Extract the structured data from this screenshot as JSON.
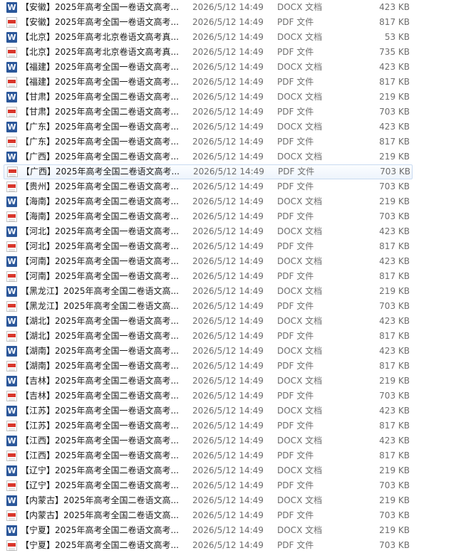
{
  "files": [
    {
      "name": "【安徽】2025年高考全国一卷语文高考...",
      "date": "2026/5/12 14:49",
      "type": "DOCX 文档",
      "size": "423 KB",
      "icon": "docx-icon",
      "selected": false
    },
    {
      "name": "【安徽】2025年高考全国一卷语文高考...",
      "date": "2026/5/12 14:49",
      "type": "PDF 文件",
      "size": "817 KB",
      "icon": "pdf-icon",
      "selected": false
    },
    {
      "name": "【北京】2025年高考北京卷语文高考真...",
      "date": "2026/5/12 14:49",
      "type": "DOCX 文档",
      "size": "53 KB",
      "icon": "docx-icon",
      "selected": false
    },
    {
      "name": "【北京】2025年高考北京卷语文高考真...",
      "date": "2026/5/12 14:49",
      "type": "PDF 文件",
      "size": "735 KB",
      "icon": "pdf-icon",
      "selected": false
    },
    {
      "name": "【福建】2025年高考全国一卷语文高考...",
      "date": "2026/5/12 14:49",
      "type": "DOCX 文档",
      "size": "423 KB",
      "icon": "docx-icon",
      "selected": false
    },
    {
      "name": "【福建】2025年高考全国一卷语文高考...",
      "date": "2026/5/12 14:49",
      "type": "PDF 文件",
      "size": "817 KB",
      "icon": "pdf-icon",
      "selected": false
    },
    {
      "name": "【甘肃】2025年高考全国二卷语文高考...",
      "date": "2026/5/12 14:49",
      "type": "DOCX 文档",
      "size": "219 KB",
      "icon": "docx-icon",
      "selected": false
    },
    {
      "name": "【甘肃】2025年高考全国二卷语文高考...",
      "date": "2026/5/12 14:49",
      "type": "PDF 文件",
      "size": "703 KB",
      "icon": "pdf-icon",
      "selected": false
    },
    {
      "name": "【广东】2025年高考全国一卷语文高考...",
      "date": "2026/5/12 14:49",
      "type": "DOCX 文档",
      "size": "423 KB",
      "icon": "docx-icon",
      "selected": false
    },
    {
      "name": "【广东】2025年高考全国一卷语文高考...",
      "date": "2026/5/12 14:49",
      "type": "PDF 文件",
      "size": "817 KB",
      "icon": "pdf-icon",
      "selected": false
    },
    {
      "name": "【广西】2025年高考全国二卷语文高考...",
      "date": "2026/5/12 14:49",
      "type": "DOCX 文档",
      "size": "219 KB",
      "icon": "docx-icon",
      "selected": false
    },
    {
      "name": "【广西】2025年高考全国二卷语文高考...",
      "date": "2026/5/12 14:49",
      "type": "PDF 文件",
      "size": "703 KB",
      "icon": "pdf-icon",
      "selected": true
    },
    {
      "name": "【贵州】2025年高考全国二卷语文高考...",
      "date": "2026/5/12 14:49",
      "type": "PDF 文件",
      "size": "703 KB",
      "icon": "pdf-icon",
      "selected": false
    },
    {
      "name": "【海南】2025年高考全国二卷语文高考...",
      "date": "2026/5/12 14:49",
      "type": "DOCX 文档",
      "size": "219 KB",
      "icon": "docx-icon",
      "selected": false
    },
    {
      "name": "【海南】2025年高考全国二卷语文高考...",
      "date": "2026/5/12 14:49",
      "type": "PDF 文件",
      "size": "703 KB",
      "icon": "pdf-icon",
      "selected": false
    },
    {
      "name": "【河北】2025年高考全国一卷语文高考...",
      "date": "2026/5/12 14:49",
      "type": "DOCX 文档",
      "size": "423 KB",
      "icon": "docx-icon",
      "selected": false
    },
    {
      "name": "【河北】2025年高考全国一卷语文高考...",
      "date": "2026/5/12 14:49",
      "type": "PDF 文件",
      "size": "817 KB",
      "icon": "pdf-icon",
      "selected": false
    },
    {
      "name": "【河南】2025年高考全国一卷语文高考...",
      "date": "2026/5/12 14:49",
      "type": "DOCX 文档",
      "size": "423 KB",
      "icon": "docx-icon",
      "selected": false
    },
    {
      "name": "【河南】2025年高考全国一卷语文高考...",
      "date": "2026/5/12 14:49",
      "type": "PDF 文件",
      "size": "817 KB",
      "icon": "pdf-icon",
      "selected": false
    },
    {
      "name": "【黑龙江】2025年高考全国二卷语文高...",
      "date": "2026/5/12 14:49",
      "type": "DOCX 文档",
      "size": "219 KB",
      "icon": "docx-icon",
      "selected": false
    },
    {
      "name": "【黑龙江】2025年高考全国二卷语文高...",
      "date": "2026/5/12 14:49",
      "type": "PDF 文件",
      "size": "703 KB",
      "icon": "pdf-icon",
      "selected": false
    },
    {
      "name": "【湖北】2025年高考全国一卷语文高考...",
      "date": "2026/5/12 14:49",
      "type": "DOCX 文档",
      "size": "423 KB",
      "icon": "docx-icon",
      "selected": false
    },
    {
      "name": "【湖北】2025年高考全国一卷语文高考...",
      "date": "2026/5/12 14:49",
      "type": "PDF 文件",
      "size": "817 KB",
      "icon": "pdf-icon",
      "selected": false
    },
    {
      "name": "【湖南】2025年高考全国一卷语文高考...",
      "date": "2026/5/12 14:49",
      "type": "DOCX 文档",
      "size": "423 KB",
      "icon": "docx-icon",
      "selected": false
    },
    {
      "name": "【湖南】2025年高考全国一卷语文高考...",
      "date": "2026/5/12 14:49",
      "type": "PDF 文件",
      "size": "817 KB",
      "icon": "pdf-icon",
      "selected": false
    },
    {
      "name": "【吉林】2025年高考全国二卷语文高考...",
      "date": "2026/5/12 14:49",
      "type": "DOCX 文档",
      "size": "219 KB",
      "icon": "docx-icon",
      "selected": false
    },
    {
      "name": "【吉林】2025年高考全国二卷语文高考...",
      "date": "2026/5/12 14:49",
      "type": "PDF 文件",
      "size": "703 KB",
      "icon": "pdf-icon",
      "selected": false
    },
    {
      "name": "【江苏】2025年高考全国一卷语文高考...",
      "date": "2026/5/12 14:49",
      "type": "DOCX 文档",
      "size": "423 KB",
      "icon": "docx-icon",
      "selected": false
    },
    {
      "name": "【江苏】2025年高考全国一卷语文高考...",
      "date": "2026/5/12 14:49",
      "type": "PDF 文件",
      "size": "817 KB",
      "icon": "pdf-icon",
      "selected": false
    },
    {
      "name": "【江西】2025年高考全国一卷语文高考...",
      "date": "2026/5/12 14:49",
      "type": "DOCX 文档",
      "size": "423 KB",
      "icon": "docx-icon",
      "selected": false
    },
    {
      "name": "【江西】2025年高考全国一卷语文高考...",
      "date": "2026/5/12 14:49",
      "type": "PDF 文件",
      "size": "817 KB",
      "icon": "pdf-icon",
      "selected": false
    },
    {
      "name": "【辽宁】2025年高考全国二卷语文高考...",
      "date": "2026/5/12 14:49",
      "type": "DOCX 文档",
      "size": "219 KB",
      "icon": "docx-icon",
      "selected": false
    },
    {
      "name": "【辽宁】2025年高考全国二卷语文高考...",
      "date": "2026/5/12 14:49",
      "type": "PDF 文件",
      "size": "703 KB",
      "icon": "pdf-icon",
      "selected": false
    },
    {
      "name": "【内蒙古】2025年高考全国二卷语文高...",
      "date": "2026/5/12 14:49",
      "type": "DOCX 文档",
      "size": "219 KB",
      "icon": "docx-icon",
      "selected": false
    },
    {
      "name": "【内蒙古】2025年高考全国二卷语文高...",
      "date": "2026/5/12 14:49",
      "type": "PDF 文件",
      "size": "703 KB",
      "icon": "pdf-icon",
      "selected": false
    },
    {
      "name": "【宁夏】2025年高考全国二卷语文高考...",
      "date": "2026/5/12 14:49",
      "type": "DOCX 文档",
      "size": "219 KB",
      "icon": "docx-icon",
      "selected": false
    },
    {
      "name": "【宁夏】2025年高考全国二卷语文高考...",
      "date": "2026/5/12 14:49",
      "type": "PDF 文件",
      "size": "703 KB",
      "icon": "pdf-icon",
      "selected": false
    }
  ]
}
